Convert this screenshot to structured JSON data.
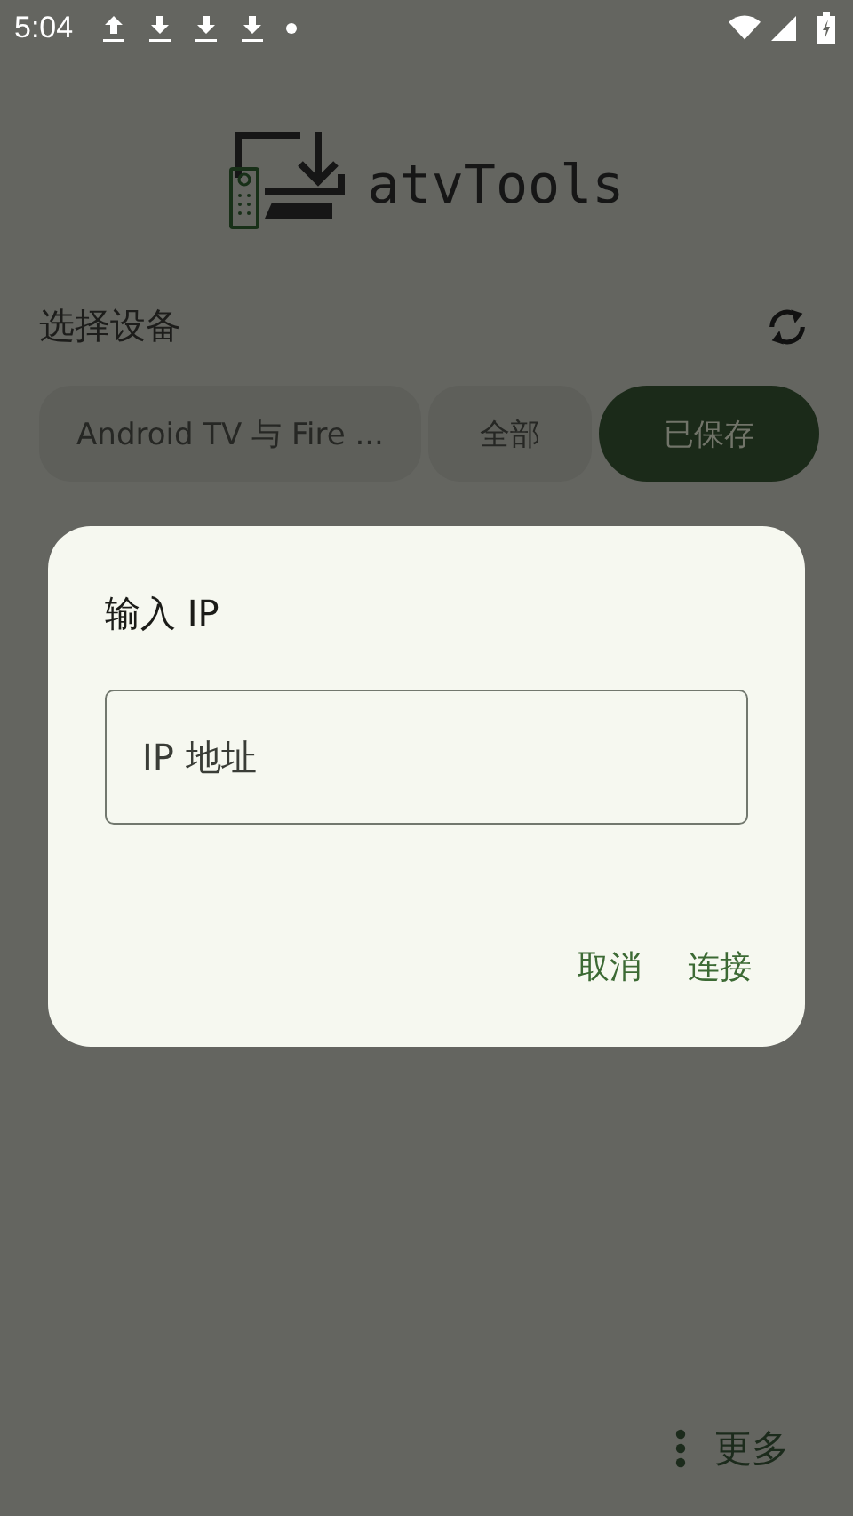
{
  "status_bar": {
    "time": "5:04"
  },
  "app": {
    "title": "atvTools"
  },
  "section": {
    "title": "选择设备"
  },
  "tabs": [
    {
      "label": "Android TV 与 Fire ...",
      "selected": false
    },
    {
      "label": "全部",
      "selected": false
    },
    {
      "label": "已保存",
      "selected": true
    }
  ],
  "dialog": {
    "title": "输入 IP",
    "field": {
      "placeholder": "IP 地址"
    },
    "buttons": [
      "取消",
      "连接"
    ]
  },
  "more_button": {
    "label": "更多"
  }
}
